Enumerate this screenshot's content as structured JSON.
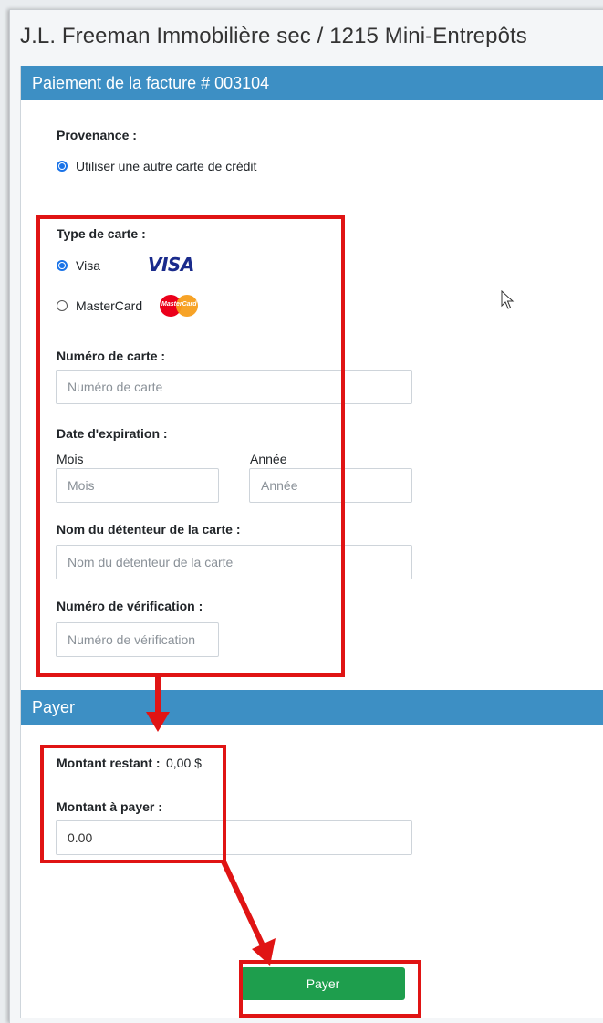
{
  "app": {
    "title": "J.L. Freeman Immobilière sec / 1215 Mini-Entrepôts"
  },
  "invoice_panel": {
    "header": "Paiement de la facture # 003104",
    "source_label": "Provenance :",
    "source_option": "Utiliser une autre carte de crédit",
    "card_type_label": "Type de carte :",
    "card_options": [
      {
        "label": "Visa",
        "logo_text": "VISA",
        "selected": true
      },
      {
        "label": "MasterCard",
        "logo_text": "MasterCard",
        "selected": false
      }
    ],
    "card_number_label": "Numéro de carte :",
    "card_number_placeholder": "Numéro de carte",
    "expiration_label": "Date d'expiration :",
    "month_label": "Mois",
    "month_placeholder": "Mois",
    "year_label": "Année",
    "year_placeholder": "Année",
    "holder_label": "Nom du détenteur de la carte :",
    "holder_placeholder": "Nom du détenteur de la carte",
    "cvv_label": "Numéro de vérification :",
    "cvv_placeholder": "Numéro de vérification"
  },
  "pay_panel": {
    "header": "Payer",
    "remaining_label": "Montant restant :",
    "remaining_value": "0,00 $",
    "amount_label": "Montant à payer :",
    "amount_value": "0.00",
    "pay_button": "Payer"
  },
  "colors": {
    "header_bg": "#3d8fc4",
    "pay_button_bg": "#1e9e4d",
    "highlight": "#e01414",
    "radio_selected": "#1a73e8"
  },
  "icons": {
    "cursor": "mouse-pointer-icon",
    "mastercard": "mastercard-logo-icon",
    "visa": "visa-logo-icon"
  }
}
